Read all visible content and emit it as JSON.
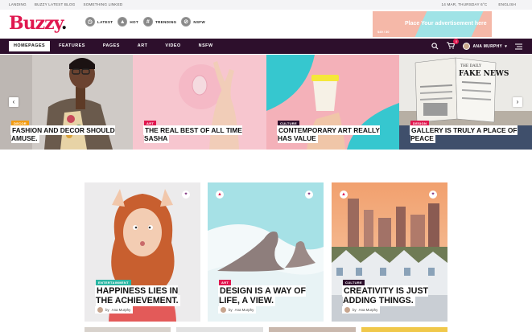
{
  "topbar": {
    "links": [
      "LANDING",
      "BUZZY LATEST BLOG",
      "SOMETHING LINKED"
    ],
    "date": "14 MAR, THURSDAY 6°C",
    "language": "ENGLISH"
  },
  "header": {
    "logo_text": "Buzzy",
    "logo_dot": ".",
    "quick_links": [
      {
        "label": "LATEST",
        "icon": "clock-icon",
        "glyph": "◷"
      },
      {
        "label": "HOT",
        "icon": "flame-icon",
        "glyph": "▲"
      },
      {
        "label": "TRENDING",
        "icon": "hash-icon",
        "glyph": "#"
      },
      {
        "label": "NSFW",
        "icon": "eye-off-icon",
        "glyph": "⊘"
      }
    ],
    "ad": {
      "title": "Place Your advertisement here",
      "sub": "$49 / 30"
    }
  },
  "nav": {
    "items": [
      "HOMEPAGES",
      "FEATURES",
      "PAGES",
      "ART",
      "VIDEO",
      "NSFW"
    ],
    "active_index": 0,
    "cart_count": "0",
    "user_name": "ANA MURPHY"
  },
  "slider": {
    "slides": [
      {
        "category": "DECOR",
        "title": "FASHION AND DECOR SHOULD AMUSE.",
        "cat_color": "#f39c12"
      },
      {
        "category": "ART",
        "title": "THE REAL BEST OF ALL TIME SASHA",
        "cat_color": "#e0174f"
      },
      {
        "category": "CULTURE",
        "title": "CONTEMPORARY ART REALLY HAS VALUE",
        "cat_color": "#2d0f2c"
      },
      {
        "category": "DESIGN",
        "title": "GALLERY IS TRULY A PLACE OF PEACE",
        "cat_color": "#e0174f"
      }
    ],
    "newspaper_text": "FAKE NEWS",
    "newspaper_top": "THE DAILY"
  },
  "cards": [
    {
      "category": "ENTERTAINMENT",
      "title": "HAPPINESS LIES IN THE ACHIEVEMENT.",
      "author_prefix": "by",
      "author": "Ana Murphy",
      "cat_color": "#2bb6a3"
    },
    {
      "category": "ART",
      "title": "DESIGN IS A WAY OF LIFE, A VIEW.",
      "author_prefix": "by",
      "author": "Ana Murphy",
      "cat_color": "#e0174f"
    },
    {
      "category": "CULTURE",
      "title": "CREATIVITY IS JUST ADDING THINGS.",
      "author_prefix": "by",
      "author": "Ana Murphy",
      "cat_color": "#2d0f2c"
    }
  ],
  "colors": {
    "brand": "#e0174f",
    "nav_bg": "#2d0f2c",
    "teal": "#2bb6a3"
  }
}
